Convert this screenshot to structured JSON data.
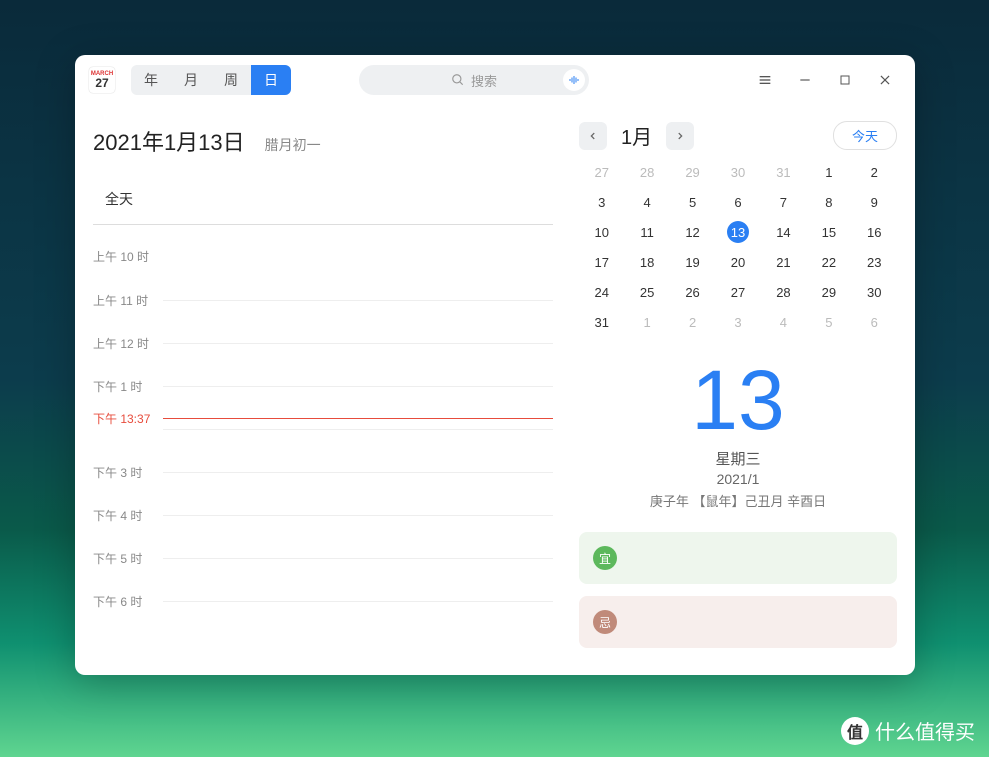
{
  "app_icon": {
    "month": "MARCH",
    "day": "27"
  },
  "view_tabs": {
    "year": "年",
    "month": "月",
    "week": "周",
    "day": "日"
  },
  "search": {
    "placeholder": "搜索"
  },
  "header": {
    "date": "2021年1月13日",
    "lunar": "腊月初一",
    "allday": "全天"
  },
  "timeline": {
    "slots": [
      "上午 10 时",
      "上午 11 时",
      "上午 12 时",
      "下午 1 时",
      "",
      "下午 3 时",
      "下午 4 时",
      "下午 5 时",
      "下午 6 时"
    ],
    "now_label": "下午 13:37"
  },
  "month_nav": {
    "month": "1月",
    "today": "今天"
  },
  "mini_cal": {
    "cells": [
      {
        "d": "27",
        "o": true
      },
      {
        "d": "28",
        "o": true
      },
      {
        "d": "29",
        "o": true
      },
      {
        "d": "30",
        "o": true
      },
      {
        "d": "31",
        "o": true
      },
      {
        "d": "1"
      },
      {
        "d": "2"
      },
      {
        "d": "3"
      },
      {
        "d": "4"
      },
      {
        "d": "5"
      },
      {
        "d": "6"
      },
      {
        "d": "7"
      },
      {
        "d": "8"
      },
      {
        "d": "9"
      },
      {
        "d": "10"
      },
      {
        "d": "11"
      },
      {
        "d": "12"
      },
      {
        "d": "13",
        "sel": true
      },
      {
        "d": "14"
      },
      {
        "d": "15"
      },
      {
        "d": "16"
      },
      {
        "d": "17"
      },
      {
        "d": "18"
      },
      {
        "d": "19"
      },
      {
        "d": "20"
      },
      {
        "d": "21"
      },
      {
        "d": "22"
      },
      {
        "d": "23"
      },
      {
        "d": "24"
      },
      {
        "d": "25"
      },
      {
        "d": "26"
      },
      {
        "d": "27"
      },
      {
        "d": "28"
      },
      {
        "d": "29"
      },
      {
        "d": "30"
      },
      {
        "d": "31"
      },
      {
        "d": "1",
        "o": true
      },
      {
        "d": "2",
        "o": true
      },
      {
        "d": "3",
        "o": true
      },
      {
        "d": "4",
        "o": true
      },
      {
        "d": "5",
        "o": true
      },
      {
        "d": "6",
        "o": true
      }
    ]
  },
  "detail": {
    "big_day": "13",
    "weekday": "星期三",
    "ym": "2021/1",
    "lunar_full": "庚子年 【鼠年】己丑月 辛酉日"
  },
  "fortune": {
    "yi": "宜",
    "ji": "忌"
  },
  "watermark": {
    "logo": "值",
    "text": "什么值得买"
  }
}
